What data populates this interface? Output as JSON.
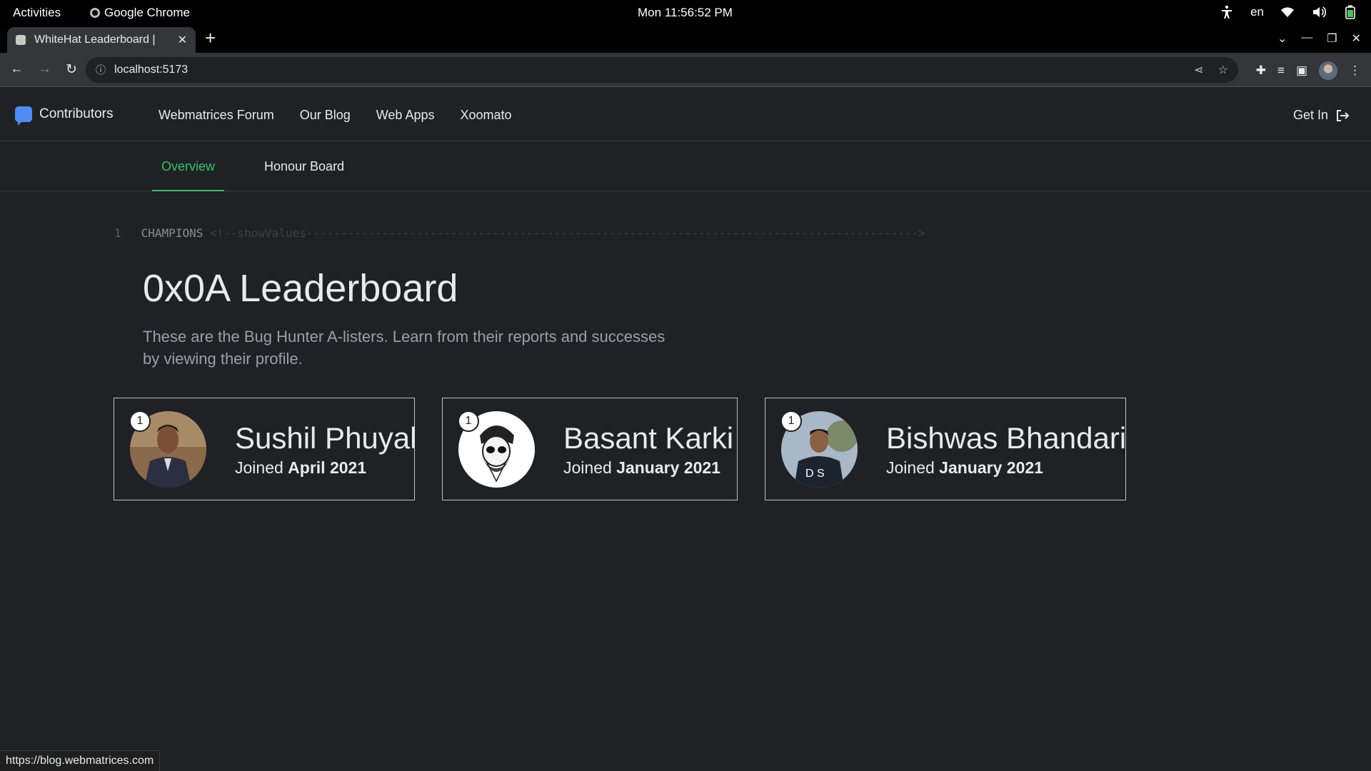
{
  "system": {
    "activities": "Activities",
    "app_name": "Google Chrome",
    "clock": "Mon 11:56:52 PM",
    "language": "en"
  },
  "browser": {
    "tab_title": "WhiteHat Leaderboard |",
    "url": "localhost:5173",
    "status_url": "https://blog.webmatrices.com"
  },
  "site": {
    "brand": "Contributors",
    "nav": [
      "Webmatrices Forum",
      "Our Blog",
      "Web Apps",
      "Xoomato"
    ],
    "get_in": "Get In",
    "tabs": [
      "Overview",
      "Honour Board"
    ]
  },
  "main": {
    "code_line_no": "1",
    "code_keyword": "CHAMPIONS",
    "code_comment": "<!--showValues----------------------------------------------------------------------------------------->",
    "title": "0x0A Leaderboard",
    "description": "These are the Bug Hunter A-listers. Learn from their reports and successes by viewing their profile."
  },
  "champions": [
    {
      "rank": "1",
      "name": "Sushil Phuyal",
      "joined_prefix": "Joined",
      "joined": "April 2021"
    },
    {
      "rank": "1",
      "name": "Basant Karki",
      "joined_prefix": "Joined",
      "joined": "January 2021"
    },
    {
      "rank": "1",
      "name": "Bishwas Bhandari",
      "joined_prefix": "Joined",
      "joined": "January 2021"
    }
  ],
  "colors": {
    "background": "#202124",
    "accent": "#34c26a",
    "brand_icon": "#4f8cf7"
  },
  "icons": {
    "tray": [
      "accessibility-icon",
      "wifi-icon",
      "volume-icon",
      "battery-icon"
    ],
    "toolbar": [
      "back-icon",
      "forward-icon",
      "reload-icon",
      "share-icon",
      "bookmark-star-icon",
      "extensions-icon",
      "reading-list-icon",
      "side-panel-icon",
      "profile-avatar",
      "menu-icon"
    ]
  }
}
